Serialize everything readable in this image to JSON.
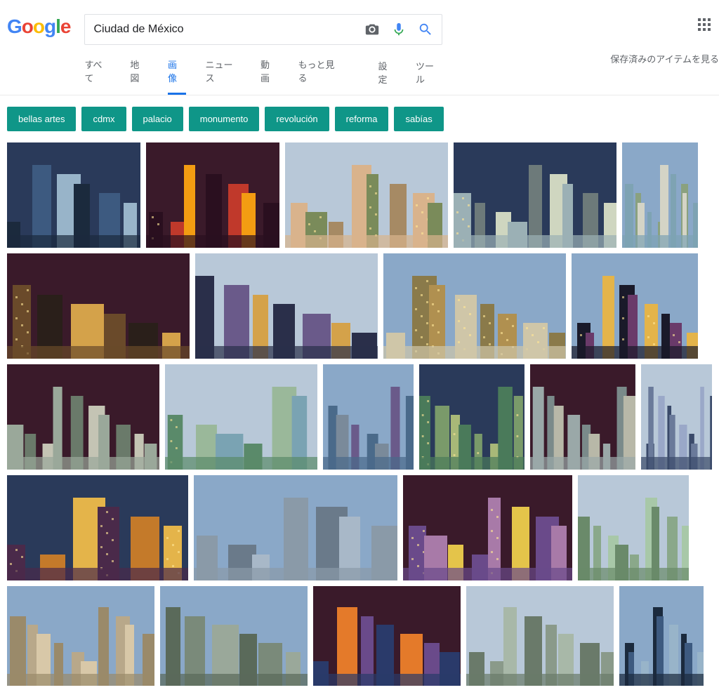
{
  "logo": "Google",
  "search": {
    "query": "Ciudad de México"
  },
  "tabs": {
    "all": "すべて",
    "maps": "地図",
    "images": "画像",
    "news": "ニュース",
    "videos": "動画",
    "more": "もっと見る"
  },
  "tools": {
    "settings": "設定",
    "tools": "ツール"
  },
  "saved_items": "保存済みのアイテムを見る",
  "chips": [
    "bellas artes",
    "cdmx",
    "palacio",
    "monumento",
    "revolución",
    "reforma",
    "sabías"
  ],
  "rows": [
    {
      "widths": [
        190,
        190,
        232,
        232,
        108
      ]
    },
    {
      "widths": [
        260,
        260,
        260,
        180
      ]
    },
    {
      "widths": [
        232,
        232,
        138,
        160,
        160,
        108
      ]
    },
    {
      "widths": [
        258,
        290,
        241,
        158
      ]
    },
    {
      "widths": [
        210,
        210,
        210,
        210,
        120
      ]
    }
  ],
  "palettes": [
    [
      "#1b2a3d",
      "#3d5a80",
      "#98b4c9"
    ],
    [
      "#2a0f1f",
      "#c0392b",
      "#f39c12"
    ],
    [
      "#d9b38c",
      "#7a8b5a",
      "#a68a64"
    ],
    [
      "#9bb0b5",
      "#6d7a7a",
      "#cfd6c0"
    ],
    [
      "#7ea3b3",
      "#8aa17f",
      "#d4d4c6"
    ],
    [
      "#6a4a2a",
      "#2a1f1a",
      "#d4a24a"
    ],
    [
      "#2a2f4a",
      "#6a5a8a",
      "#d4a24a"
    ],
    [
      "#cfc6a8",
      "#8a7a4a",
      "#b09050"
    ],
    [
      "#1a1a2a",
      "#6a3a6a",
      "#e4b44a"
    ],
    [
      "#9aa89a",
      "#6a7a6a",
      "#c4c4b4"
    ],
    [
      "#5a8a6a",
      "#9ab89a",
      "#7aa3b3"
    ],
    [
      "#4a6a8a",
      "#7a8a9a",
      "#6a5a8a"
    ],
    [
      "#4a7a5a",
      "#7a9a6a",
      "#a8b878"
    ],
    [
      "#9aa8a8",
      "#7a8a8a",
      "#b8b8a8"
    ],
    [
      "#3a4a6a",
      "#6a7a9a",
      "#9aa8c8"
    ],
    [
      "#4a2a4a",
      "#c47a2a",
      "#e4b44a"
    ],
    [
      "#8a9aa8",
      "#6a7a8a",
      "#a8b8c8"
    ],
    [
      "#6a4a8a",
      "#a87aa8",
      "#e4c44a"
    ],
    [
      "#6a8a6a",
      "#8aa88a",
      "#a8c8a8"
    ],
    [
      "#9a8a6a",
      "#b8a88a",
      "#d8c8a8"
    ],
    [
      "#5a6a5a",
      "#7a8a7a",
      "#9aa89a"
    ],
    [
      "#2a3a6a",
      "#e47a2a",
      "#6a4a8a"
    ],
    [
      "#6a7a6a",
      "#8a9a8a",
      "#a8b8a8"
    ]
  ]
}
